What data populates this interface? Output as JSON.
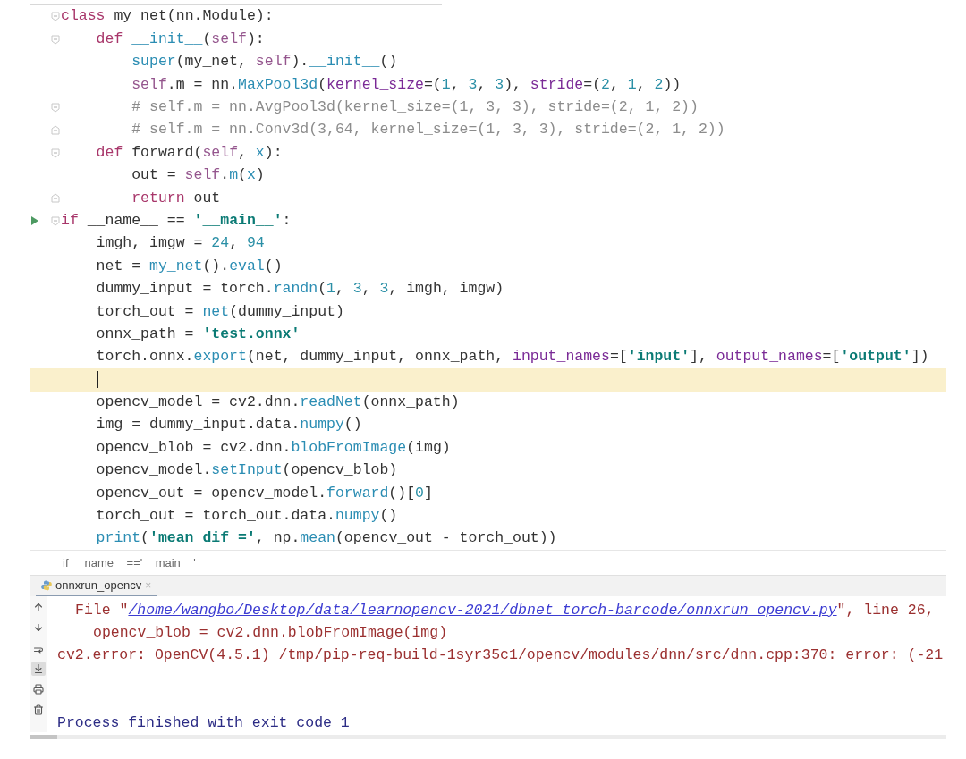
{
  "editor": {
    "lines": [
      {
        "current": false,
        "run": false,
        "fold_start": true,
        "fold_end": false,
        "tokens": [
          {
            "kind": "keyword",
            "text": "class"
          },
          {
            "kind": "plain",
            "text": " my_net(nn.Module):"
          }
        ],
        "children": [
          {
            "current": false,
            "run": false,
            "fold_start": true,
            "fold_end": false,
            "tokens": [
              {
                "kind": "keyword",
                "text": "def"
              },
              {
                "kind": "func",
                "text": " __init__"
              },
              {
                "kind": "plain",
                "text": "("
              },
              {
                "kind": "self",
                "text": "self"
              },
              {
                "kind": "plain",
                "text": "):"
              }
            ],
            "children": [
              {
                "current": false,
                "run": false,
                "fold_start": false,
                "fold_end": false,
                "tokens": [
                  {
                    "kind": "func",
                    "text": "super"
                  },
                  {
                    "kind": "plain",
                    "text": "(my_net, "
                  },
                  {
                    "kind": "self",
                    "text": "self"
                  },
                  {
                    "kind": "plain",
                    "text": ")."
                  },
                  {
                    "kind": "func",
                    "text": "__init__"
                  },
                  {
                    "kind": "plain",
                    "text": "()"
                  }
                ]
              },
              {
                "current": false,
                "run": false,
                "fold_start": false,
                "fold_end": false,
                "tokens": [
                  {
                    "kind": "self",
                    "text": "self"
                  },
                  {
                    "kind": "plain",
                    "text": ".m = nn."
                  },
                  {
                    "kind": "func",
                    "text": "MaxPool3d"
                  },
                  {
                    "kind": "plain",
                    "text": "("
                  },
                  {
                    "kind": "param",
                    "text": "kernel_size"
                  },
                  {
                    "kind": "plain",
                    "text": "=("
                  },
                  {
                    "kind": "number",
                    "text": "1"
                  },
                  {
                    "kind": "plain",
                    "text": ", "
                  },
                  {
                    "kind": "number",
                    "text": "3"
                  },
                  {
                    "kind": "plain",
                    "text": ", "
                  },
                  {
                    "kind": "number",
                    "text": "3"
                  },
                  {
                    "kind": "plain",
                    "text": "), "
                  },
                  {
                    "kind": "param",
                    "text": "stride"
                  },
                  {
                    "kind": "plain",
                    "text": "=("
                  },
                  {
                    "kind": "number",
                    "text": "2"
                  },
                  {
                    "kind": "plain",
                    "text": ", "
                  },
                  {
                    "kind": "number",
                    "text": "1"
                  },
                  {
                    "kind": "plain",
                    "text": ", "
                  },
                  {
                    "kind": "number",
                    "text": "2"
                  },
                  {
                    "kind": "plain",
                    "text": "))"
                  }
                ]
              },
              {
                "current": false,
                "run": false,
                "fold_start": true,
                "fold_end": false,
                "tokens": [
                  {
                    "kind": "comment",
                    "text": "# self.m = nn.AvgPool3d(kernel_size=(1, 3, 3), stride=(2, 1, 2))"
                  }
                ]
              },
              {
                "current": false,
                "run": false,
                "fold_start": false,
                "fold_end": true,
                "tokens": [
                  {
                    "kind": "comment",
                    "text": "# self.m = nn.Conv3d(3,64, kernel_size=(1, 3, 3), stride=(2, 1, 2))"
                  }
                ]
              }
            ]
          },
          {
            "current": false,
            "run": false,
            "fold_start": true,
            "fold_end": false,
            "tokens": [
              {
                "kind": "keyword",
                "text": "def"
              },
              {
                "kind": "plain",
                "text": " forward("
              },
              {
                "kind": "self",
                "text": "self"
              },
              {
                "kind": "plain",
                "text": ", "
              },
              {
                "kind": "func",
                "text": "x"
              },
              {
                "kind": "plain",
                "text": "):"
              }
            ],
            "children": [
              {
                "current": false,
                "run": false,
                "fold_start": false,
                "fold_end": false,
                "tokens": [
                  {
                    "kind": "plain",
                    "text": "out = "
                  },
                  {
                    "kind": "self",
                    "text": "self"
                  },
                  {
                    "kind": "plain",
                    "text": "."
                  },
                  {
                    "kind": "func",
                    "text": "m"
                  },
                  {
                    "kind": "plain",
                    "text": "("
                  },
                  {
                    "kind": "func",
                    "text": "x"
                  },
                  {
                    "kind": "plain",
                    "text": ")"
                  }
                ]
              },
              {
                "current": false,
                "run": false,
                "fold_start": false,
                "fold_end": true,
                "tokens": [
                  {
                    "kind": "keyword",
                    "text": "return"
                  },
                  {
                    "kind": "plain",
                    "text": " out"
                  }
                ]
              }
            ]
          }
        ]
      },
      {
        "current": false,
        "run": true,
        "fold_start": true,
        "fold_end": false,
        "tokens": [
          {
            "kind": "keyword",
            "text": "if"
          },
          {
            "kind": "plain",
            "text": " __name__ == "
          },
          {
            "kind": "string",
            "text": "'__main__'"
          },
          {
            "kind": "plain",
            "text": ":"
          }
        ],
        "children": [
          {
            "current": false,
            "run": false,
            "fold_start": false,
            "fold_end": false,
            "tokens": [
              {
                "kind": "plain",
                "text": "imgh, imgw = "
              },
              {
                "kind": "number",
                "text": "24"
              },
              {
                "kind": "plain",
                "text": ", "
              },
              {
                "kind": "number",
                "text": "94"
              }
            ]
          },
          {
            "current": false,
            "run": false,
            "fold_start": false,
            "fold_end": false,
            "tokens": [
              {
                "kind": "plain",
                "text": "net = "
              },
              {
                "kind": "func",
                "text": "my_net"
              },
              {
                "kind": "plain",
                "text": "()."
              },
              {
                "kind": "func",
                "text": "eval"
              },
              {
                "kind": "plain",
                "text": "()"
              }
            ]
          },
          {
            "current": false,
            "run": false,
            "fold_start": false,
            "fold_end": false,
            "tokens": [
              {
                "kind": "plain",
                "text": "dummy_input = torch."
              },
              {
                "kind": "func",
                "text": "randn"
              },
              {
                "kind": "plain",
                "text": "("
              },
              {
                "kind": "number",
                "text": "1"
              },
              {
                "kind": "plain",
                "text": ", "
              },
              {
                "kind": "number",
                "text": "3"
              },
              {
                "kind": "plain",
                "text": ", "
              },
              {
                "kind": "number",
                "text": "3"
              },
              {
                "kind": "plain",
                "text": ", imgh, imgw)"
              }
            ]
          },
          {
            "current": false,
            "run": false,
            "fold_start": false,
            "fold_end": false,
            "tokens": [
              {
                "kind": "plain",
                "text": "torch_out = "
              },
              {
                "kind": "func",
                "text": "net"
              },
              {
                "kind": "plain",
                "text": "(dummy_input)"
              }
            ]
          },
          {
            "current": false,
            "run": false,
            "fold_start": false,
            "fold_end": false,
            "tokens": [
              {
                "kind": "plain",
                "text": "onnx_path = "
              },
              {
                "kind": "string",
                "text": "'test.onnx'"
              }
            ]
          },
          {
            "current": false,
            "run": false,
            "fold_start": false,
            "fold_end": false,
            "tokens": [
              {
                "kind": "plain",
                "text": "torch.onnx."
              },
              {
                "kind": "func",
                "text": "export"
              },
              {
                "kind": "plain",
                "text": "(net, dummy_input, onnx_path, "
              },
              {
                "kind": "param",
                "text": "input_names"
              },
              {
                "kind": "plain",
                "text": "=["
              },
              {
                "kind": "string",
                "text": "'input'"
              },
              {
                "kind": "plain",
                "text": "], "
              },
              {
                "kind": "param",
                "text": "output_names"
              },
              {
                "kind": "plain",
                "text": "=["
              },
              {
                "kind": "string",
                "text": "'output'"
              },
              {
                "kind": "plain",
                "text": "])"
              }
            ]
          },
          {
            "current": true,
            "run": false,
            "fold_start": false,
            "fold_end": false
          },
          {
            "current": false,
            "run": false,
            "fold_start": false,
            "fold_end": false,
            "tokens": [
              {
                "kind": "plain",
                "text": "opencv_model = cv2.dnn."
              },
              {
                "kind": "func",
                "text": "readNet"
              },
              {
                "kind": "plain",
                "text": "(onnx_path)"
              }
            ]
          },
          {
            "current": false,
            "run": false,
            "fold_start": false,
            "fold_end": false,
            "tokens": [
              {
                "kind": "plain",
                "text": "img = dummy_input.data."
              },
              {
                "kind": "func",
                "text": "numpy"
              },
              {
                "kind": "plain",
                "text": "()"
              }
            ]
          },
          {
            "current": false,
            "run": false,
            "fold_start": false,
            "fold_end": false,
            "tokens": [
              {
                "kind": "plain",
                "text": "opencv_blob = cv2.dnn."
              },
              {
                "kind": "func",
                "text": "blobFromImage"
              },
              {
                "kind": "plain",
                "text": "(img)"
              }
            ]
          },
          {
            "current": false,
            "run": false,
            "fold_start": false,
            "fold_end": false,
            "tokens": [
              {
                "kind": "plain",
                "text": "opencv_model."
              },
              {
                "kind": "func",
                "text": "setInput"
              },
              {
                "kind": "plain",
                "text": "(opencv_blob)"
              }
            ]
          },
          {
            "current": false,
            "run": false,
            "fold_start": false,
            "fold_end": false,
            "tokens": [
              {
                "kind": "plain",
                "text": "opencv_out = opencv_model."
              },
              {
                "kind": "func",
                "text": "forward"
              },
              {
                "kind": "plain",
                "text": "()["
              },
              {
                "kind": "number",
                "text": "0"
              },
              {
                "kind": "plain",
                "text": "]"
              }
            ]
          },
          {
            "current": false,
            "run": false,
            "fold_start": false,
            "fold_end": false,
            "tokens": [
              {
                "kind": "plain",
                "text": "torch_out = torch_out.data."
              },
              {
                "kind": "func",
                "text": "numpy"
              },
              {
                "kind": "plain",
                "text": "()"
              }
            ]
          },
          {
            "current": false,
            "run": false,
            "fold_start": false,
            "fold_end": false,
            "tokens": [
              {
                "kind": "func",
                "text": "print"
              },
              {
                "kind": "plain",
                "text": "("
              },
              {
                "kind": "string",
                "text": "'mean dif ='"
              },
              {
                "kind": "plain",
                "text": ", np."
              },
              {
                "kind": "func",
                "text": "mean"
              },
              {
                "kind": "plain",
                "text": "(opencv_out - torch_out))"
              }
            ]
          }
        ]
      }
    ]
  },
  "breadcrumb": "if __name__=='__main__'",
  "run_panel": {
    "tabs": [
      {
        "label": "onnxrun_opencv",
        "close": "×",
        "selected": true
      }
    ],
    "toolbar": [
      {
        "kind": "up",
        "selected": false
      },
      {
        "kind": "down",
        "selected": false
      },
      {
        "kind": "wrap",
        "selected": false
      },
      {
        "kind": "scroll_end",
        "selected": true
      },
      {
        "kind": "print",
        "selected": false
      },
      {
        "kind": "clear",
        "selected": false
      }
    ],
    "console": [
      {
        "kind": "trace",
        "segments": [
          {
            "kind": "error",
            "text": "File \""
          },
          {
            "kind": "link",
            "text": "/home/wangbo/Desktop/data/learnopencv-2021/dbnet_torch-barcode/onnxrun_opencv.py"
          },
          {
            "kind": "error",
            "text": "\", line 26,"
          }
        ]
      },
      {
        "kind": "trace_code",
        "segments": [
          {
            "kind": "error",
            "text": "opencv_blob = cv2.dnn.blobFromImage(img)"
          }
        ]
      },
      {
        "kind": "plain",
        "segments": [
          {
            "kind": "error",
            "text": "cv2.error: OpenCV(4.5.1) /tmp/pip-req-build-1syr35c1/opencv/modules/dnn/src/dnn.cpp:370: error: (-21"
          }
        ]
      },
      {
        "kind": "exit",
        "segments": [
          {
            "kind": "info",
            "text": "Process finished with exit code 1"
          }
        ]
      }
    ]
  }
}
